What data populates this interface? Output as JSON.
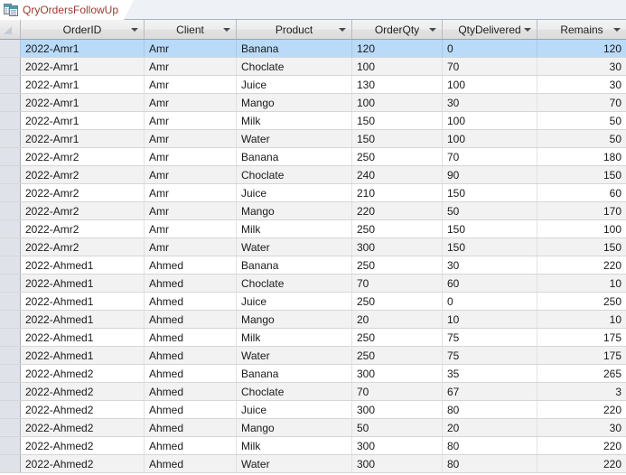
{
  "tab": {
    "label": "QryOrdersFollowUp",
    "icon": "query-datasheet-icon",
    "label_color": "#9c3b2f"
  },
  "table": {
    "columns": [
      {
        "key": "order_id",
        "label": "OrderID",
        "align": "left",
        "filter_arrow": true
      },
      {
        "key": "client",
        "label": "Client",
        "align": "left",
        "filter_arrow": true
      },
      {
        "key": "product",
        "label": "Product",
        "align": "left",
        "filter_arrow": true
      },
      {
        "key": "order_qty",
        "label": "OrderQty",
        "align": "left",
        "filter_arrow": true
      },
      {
        "key": "qty_delivered",
        "label": "QtyDelivered",
        "align": "left",
        "filter_arrow": true
      },
      {
        "key": "remains",
        "label": "Remains",
        "align": "right",
        "filter_arrow": true
      }
    ],
    "selected_row_index": 0,
    "selection_color": "#b9daf8",
    "alt_row_color": "#f2f2f2",
    "rows": [
      {
        "order_id": "2022-Amr1",
        "client": "Amr",
        "product": "Banana",
        "order_qty": "120",
        "qty_delivered": "0",
        "remains": "120"
      },
      {
        "order_id": "2022-Amr1",
        "client": "Amr",
        "product": "Choclate",
        "order_qty": "100",
        "qty_delivered": "70",
        "remains": "30"
      },
      {
        "order_id": "2022-Amr1",
        "client": "Amr",
        "product": "Juice",
        "order_qty": "130",
        "qty_delivered": "100",
        "remains": "30"
      },
      {
        "order_id": "2022-Amr1",
        "client": "Amr",
        "product": "Mango",
        "order_qty": "100",
        "qty_delivered": "30",
        "remains": "70"
      },
      {
        "order_id": "2022-Amr1",
        "client": "Amr",
        "product": "Milk",
        "order_qty": "150",
        "qty_delivered": "100",
        "remains": "50"
      },
      {
        "order_id": "2022-Amr1",
        "client": "Amr",
        "product": "Water",
        "order_qty": "150",
        "qty_delivered": "100",
        "remains": "50"
      },
      {
        "order_id": "2022-Amr2",
        "client": "Amr",
        "product": "Banana",
        "order_qty": "250",
        "qty_delivered": "70",
        "remains": "180"
      },
      {
        "order_id": "2022-Amr2",
        "client": "Amr",
        "product": "Choclate",
        "order_qty": "240",
        "qty_delivered": "90",
        "remains": "150"
      },
      {
        "order_id": "2022-Amr2",
        "client": "Amr",
        "product": "Juice",
        "order_qty": "210",
        "qty_delivered": "150",
        "remains": "60"
      },
      {
        "order_id": "2022-Amr2",
        "client": "Amr",
        "product": "Mango",
        "order_qty": "220",
        "qty_delivered": "50",
        "remains": "170"
      },
      {
        "order_id": "2022-Amr2",
        "client": "Amr",
        "product": "Milk",
        "order_qty": "250",
        "qty_delivered": "150",
        "remains": "100"
      },
      {
        "order_id": "2022-Amr2",
        "client": "Amr",
        "product": "Water",
        "order_qty": "300",
        "qty_delivered": "150",
        "remains": "150"
      },
      {
        "order_id": "2022-Ahmed1",
        "client": "Ahmed",
        "product": "Banana",
        "order_qty": "250",
        "qty_delivered": "30",
        "remains": "220"
      },
      {
        "order_id": "2022-Ahmed1",
        "client": "Ahmed",
        "product": "Choclate",
        "order_qty": "70",
        "qty_delivered": "60",
        "remains": "10"
      },
      {
        "order_id": "2022-Ahmed1",
        "client": "Ahmed",
        "product": "Juice",
        "order_qty": "250",
        "qty_delivered": "0",
        "remains": "250"
      },
      {
        "order_id": "2022-Ahmed1",
        "client": "Ahmed",
        "product": "Mango",
        "order_qty": "20",
        "qty_delivered": "10",
        "remains": "10"
      },
      {
        "order_id": "2022-Ahmed1",
        "client": "Ahmed",
        "product": "Milk",
        "order_qty": "250",
        "qty_delivered": "75",
        "remains": "175"
      },
      {
        "order_id": "2022-Ahmed1",
        "client": "Ahmed",
        "product": "Water",
        "order_qty": "250",
        "qty_delivered": "75",
        "remains": "175"
      },
      {
        "order_id": "2022-Ahmed2",
        "client": "Ahmed",
        "product": "Banana",
        "order_qty": "300",
        "qty_delivered": "35",
        "remains": "265"
      },
      {
        "order_id": "2022-Ahmed2",
        "client": "Ahmed",
        "product": "Choclate",
        "order_qty": "70",
        "qty_delivered": "67",
        "remains": "3"
      },
      {
        "order_id": "2022-Ahmed2",
        "client": "Ahmed",
        "product": "Juice",
        "order_qty": "300",
        "qty_delivered": "80",
        "remains": "220"
      },
      {
        "order_id": "2022-Ahmed2",
        "client": "Ahmed",
        "product": "Mango",
        "order_qty": "50",
        "qty_delivered": "20",
        "remains": "30"
      },
      {
        "order_id": "2022-Ahmed2",
        "client": "Ahmed",
        "product": "Milk",
        "order_qty": "300",
        "qty_delivered": "80",
        "remains": "220"
      },
      {
        "order_id": "2022-Ahmed2",
        "client": "Ahmed",
        "product": "Water",
        "order_qty": "300",
        "qty_delivered": "80",
        "remains": "220"
      }
    ]
  }
}
